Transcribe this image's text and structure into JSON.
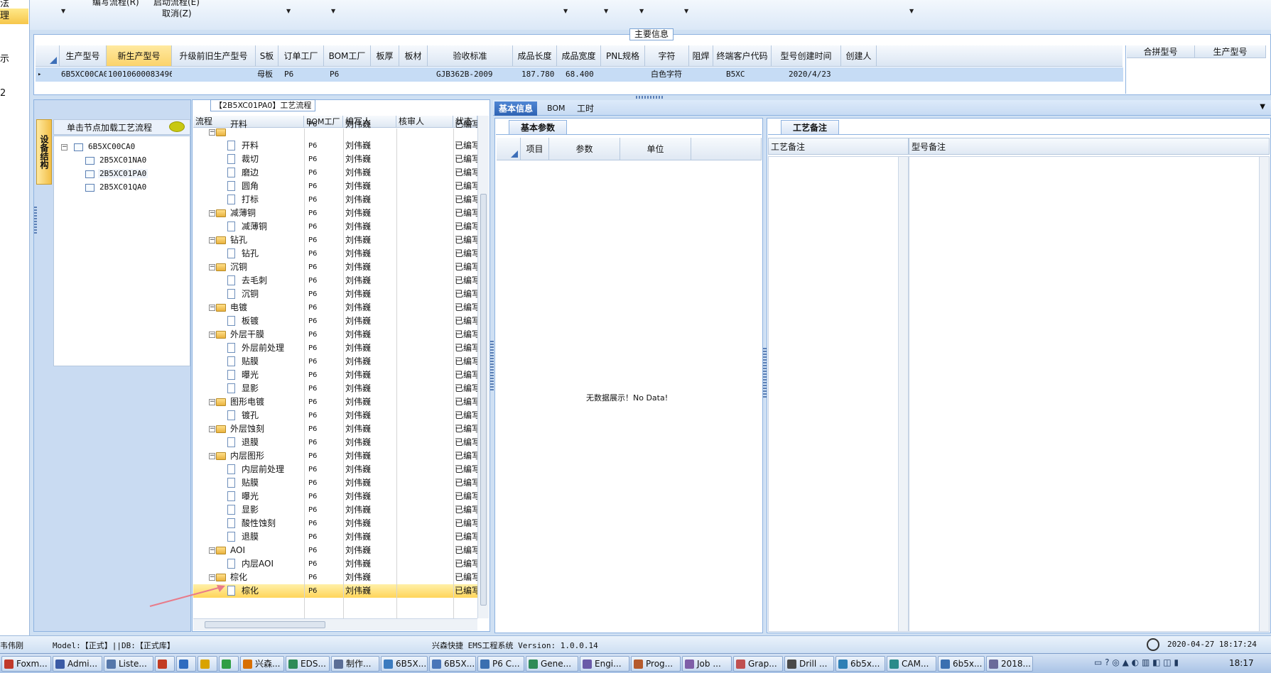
{
  "top": {
    "menu1": "编写流程(R)",
    "menu2": "启动流程(E)",
    "menu3": "取消(Z)",
    "left_top_label": "法"
  },
  "left_strip": {
    "selected": "理",
    "item1": "示",
    "item2": "2"
  },
  "main_info": {
    "group_label": "主要信息",
    "columns": [
      "生产型号",
      "新生产型号",
      "升级前旧生产型号",
      "S板",
      "订单工厂",
      "BOM工厂",
      "板厚",
      "板材",
      "验收标准",
      "成品长度",
      "成品宽度",
      "PNL规格",
      "字符",
      "阻焊",
      "终端客户代码",
      "型号创建时间",
      "创建人"
    ],
    "row": [
      "6B5XC00CA0",
      "10010600083496",
      "",
      "母板",
      "P6",
      "P6",
      "",
      "",
      "GJB362B-2009",
      "187.780",
      "68.400",
      "",
      "白色字符",
      "",
      "B5XC",
      "2020/4/23",
      ""
    ],
    "right_columns": [
      "合拼型号",
      "生产型号"
    ],
    "row_marker": "▸"
  },
  "left_panel": {
    "vertical_tab": "设备结构",
    "hint": "单击节点加载工艺流程",
    "tree": [
      "6B5XC00CA0",
      "2B5XC01NA0",
      "2B5XC01PA0",
      "2B5XC01QA0"
    ]
  },
  "flow": {
    "title": "【2B5XC01PA0】工艺流程",
    "columns": [
      "流程",
      "BOM工厂",
      "编写人",
      "核审人",
      "状态"
    ],
    "rows": [
      {
        "name": "开料",
        "level": 1,
        "type": "folder",
        "partial": true
      },
      {
        "name": "开料",
        "level": 2,
        "type": "doc"
      },
      {
        "name": "裁切",
        "level": 2,
        "type": "doc"
      },
      {
        "name": "磨边",
        "level": 2,
        "type": "doc"
      },
      {
        "name": "圆角",
        "level": 2,
        "type": "doc"
      },
      {
        "name": "打标",
        "level": 2,
        "type": "doc"
      },
      {
        "name": "减薄铜",
        "level": 1,
        "type": "folder"
      },
      {
        "name": "减薄铜",
        "level": 2,
        "type": "doc"
      },
      {
        "name": "钻孔",
        "level": 1,
        "type": "folder"
      },
      {
        "name": "钻孔",
        "level": 2,
        "type": "doc"
      },
      {
        "name": "沉铜",
        "level": 1,
        "type": "folder"
      },
      {
        "name": "去毛刺",
        "level": 2,
        "type": "doc"
      },
      {
        "name": "沉铜",
        "level": 2,
        "type": "doc"
      },
      {
        "name": "电镀",
        "level": 1,
        "type": "folder"
      },
      {
        "name": "板镀",
        "level": 2,
        "type": "doc"
      },
      {
        "name": "外层干膜",
        "level": 1,
        "type": "folder"
      },
      {
        "name": "外层前处理",
        "level": 2,
        "type": "doc"
      },
      {
        "name": "贴膜",
        "level": 2,
        "type": "doc"
      },
      {
        "name": "曝光",
        "level": 2,
        "type": "doc"
      },
      {
        "name": "显影",
        "level": 2,
        "type": "doc"
      },
      {
        "name": "图形电镀",
        "level": 1,
        "type": "folder"
      },
      {
        "name": "镀孔",
        "level": 2,
        "type": "doc"
      },
      {
        "name": "外层蚀刻",
        "level": 1,
        "type": "folder"
      },
      {
        "name": "退膜",
        "level": 2,
        "type": "doc"
      },
      {
        "name": "内层图形",
        "level": 1,
        "type": "folder"
      },
      {
        "name": "内层前处理",
        "level": 2,
        "type": "doc"
      },
      {
        "name": "贴膜",
        "level": 2,
        "type": "doc"
      },
      {
        "name": "曝光",
        "level": 2,
        "type": "doc"
      },
      {
        "name": "显影",
        "level": 2,
        "type": "doc"
      },
      {
        "name": "酸性蚀刻",
        "level": 2,
        "type": "doc"
      },
      {
        "name": "退膜",
        "level": 2,
        "type": "doc"
      },
      {
        "name": "AOI",
        "level": 1,
        "type": "folder"
      },
      {
        "name": "内层AOI",
        "level": 2,
        "type": "doc"
      },
      {
        "name": "棕化",
        "level": 1,
        "type": "folder"
      },
      {
        "name": "棕化",
        "level": 2,
        "type": "doc",
        "selected": true
      }
    ],
    "factory": "P6",
    "writer": "刘伟巍",
    "status": "已编写"
  },
  "tabs": [
    "基本信息",
    "BOM",
    "工时"
  ],
  "basic_params": {
    "title": "基本参数",
    "columns": [
      "项目",
      "参数",
      "单位"
    ],
    "empty": "无数据展示！No Data!"
  },
  "remarks": {
    "title": "工艺备注",
    "col1": "工艺备注",
    "col2": "型号备注"
  },
  "statusbar": {
    "user": "韦伟刚",
    "model": "Model:【正式】||DB:【正式库】",
    "app": "兴森快捷 EMS工程系统 Version: 1.0.0.14",
    "datetime": "2020-04-27 18:17:24"
  },
  "taskbar": {
    "items": [
      "Foxm...",
      "Admi...",
      "Liste...",
      "",
      "",
      "",
      "",
      "兴森...",
      "EDS...",
      "制作...",
      "6B5X...",
      "6B5X...",
      "P6 C...",
      "Gene...",
      "Engi...",
      "Prog...",
      "Job ...",
      "Grap...",
      "Drill ...",
      "6b5x...",
      "CAM...",
      "6b5x...",
      "2018..."
    ],
    "clock": "18:17"
  },
  "colors": {
    "accent": "#2e63b3",
    "highlight": "#fbd36b",
    "selected_row": "#ffe27a"
  }
}
